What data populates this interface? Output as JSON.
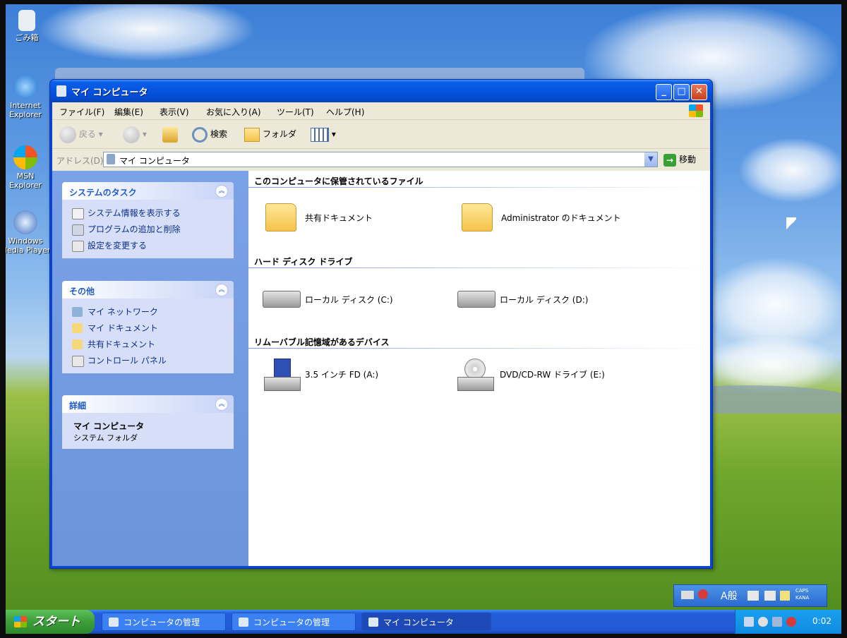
{
  "desktop": {
    "icons": [
      {
        "label": "ごみ箱"
      },
      {
        "label": "Internet Explorer"
      },
      {
        "label": "MSN Explorer"
      },
      {
        "label": "Windows Media Player"
      }
    ]
  },
  "window": {
    "title": "マイ コンピュータ",
    "menu": [
      "ファイル(F)",
      "編集(E)",
      "表示(V)",
      "お気に入り(A)",
      "ツール(T)",
      "ヘルプ(H)"
    ],
    "toolbar": {
      "back": "戻る",
      "search": "検索",
      "folders": "フォルダ"
    },
    "address": {
      "label": "アドレス(D)",
      "value": "マイ コンピュータ",
      "go": "移動"
    },
    "side": {
      "tasks": {
        "title": "システムのタスク",
        "items": [
          "システム情報を表示する",
          "プログラムの追加と削除",
          "設定を変更する"
        ]
      },
      "other": {
        "title": "その他",
        "items": [
          "マイ ネットワーク",
          "マイ ドキュメント",
          "共有ドキュメント",
          "コントロール パネル"
        ]
      },
      "details": {
        "title": "詳細",
        "name": "マイ コンピュータ",
        "type": "システム フォルダ"
      }
    },
    "groups": {
      "files": {
        "title": "このコンピュータに保管されているファイル",
        "items": [
          "共有ドキュメント",
          "Administrator のドキュメント"
        ]
      },
      "hdd": {
        "title": "ハード ディスク ドライブ",
        "items": [
          "ローカル ディスク (C:)",
          "ローカル ディスク (D:)"
        ]
      },
      "removable": {
        "title": "リムーバブル記憶域があるデバイス",
        "items": [
          "3.5 インチ FD (A:)",
          "DVD/CD-RW ドライブ (E:)"
        ]
      }
    }
  },
  "taskbar": {
    "start": "スタート",
    "tasks": [
      "コンピュータの管理",
      "コンピュータの管理",
      "マイ コンピュータ"
    ],
    "clock": "0:02",
    "langbar": "A般",
    "langbar_mode": "CAPS KANA"
  }
}
